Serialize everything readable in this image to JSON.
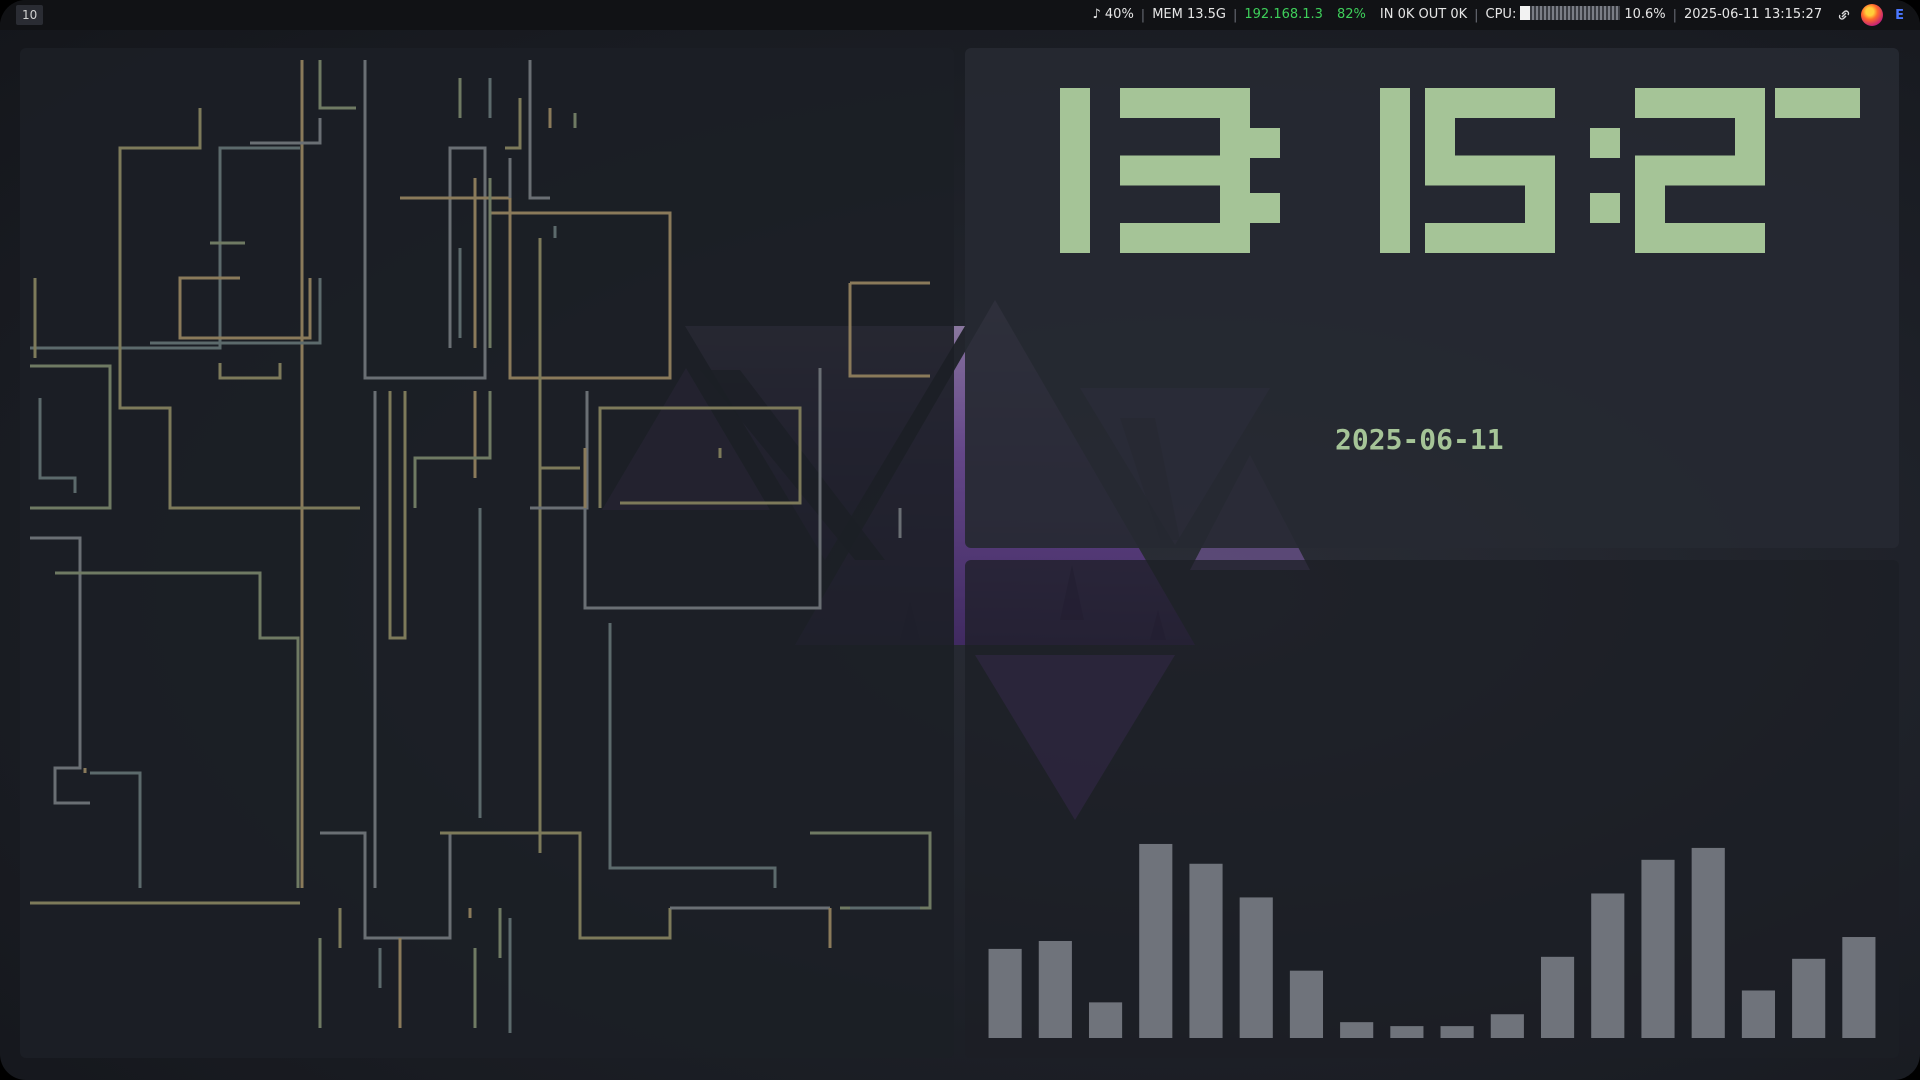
{
  "bar": {
    "workspace": "10",
    "volume": "♪ 40%",
    "mem": "MEM 13.5G",
    "ip": "192.168.1.3",
    "battery": "82%",
    "net": "IN 0K OUT 0K",
    "cpu_label": "CPU:",
    "cpu_percent": "10.6%",
    "datetime": "2025-06-11 13:15:27",
    "tray_link_icon": "link-icon",
    "tray_browser_icon": "firefox-icon",
    "tray_text": "E"
  },
  "clock": {
    "time": "13:15:27",
    "date": "2025-06-11",
    "digit_color": "#a5c497"
  },
  "visualizer": {
    "bar_color": "#6f737b",
    "levels": [
      0.45,
      0.49,
      0.18,
      0.98,
      0.88,
      0.71,
      0.34,
      0.08,
      0.06,
      0.06,
      0.12,
      0.41,
      0.73,
      0.9,
      0.96,
      0.24,
      0.4,
      0.51
    ]
  },
  "wallpaper": {
    "accent": "#7a4fa8"
  }
}
